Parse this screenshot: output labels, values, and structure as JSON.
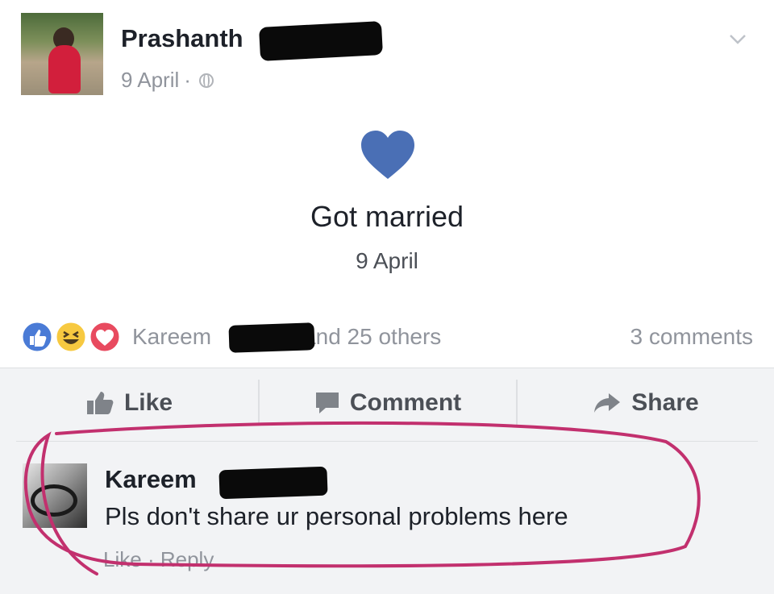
{
  "post": {
    "author": "Prashanth",
    "date": "9 April",
    "meta_separator": "·",
    "audience_icon": "globe-icon",
    "menu_icon": "chevron-down-icon"
  },
  "life_event": {
    "icon": "heart-icon",
    "icon_color": "#4a6fb5",
    "title": "Got married",
    "date": "9 April"
  },
  "reactions": {
    "icons": [
      "like-reaction-icon",
      "haha-reaction-icon",
      "love-reaction-icon"
    ],
    "name": "Kareem",
    "suffix": "and 25 others",
    "comments_count": "3 comments"
  },
  "actions": {
    "like": "Like",
    "comment": "Comment",
    "share": "Share"
  },
  "comment": {
    "author": "Kareem",
    "text": "Pls don't share ur personal problems here",
    "like": "Like",
    "separator": "·",
    "reply": "Reply"
  },
  "colors": {
    "highlight": "#c2306e",
    "link_blue": "#4267b2",
    "muted": "#90949c"
  }
}
